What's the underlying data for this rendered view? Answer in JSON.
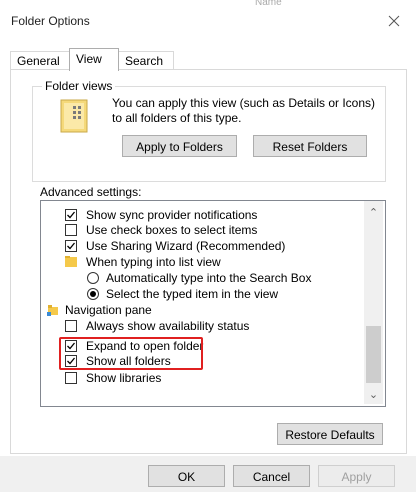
{
  "window": {
    "title": "Folder Options",
    "close_icon": "close-icon",
    "background_text": "Name"
  },
  "tabs": [
    {
      "label": "General",
      "active": false
    },
    {
      "label": "View",
      "active": true
    },
    {
      "label": "Search",
      "active": false
    }
  ],
  "folder_views": {
    "group_label": "Folder views",
    "description": "You can apply this view (such as Details or Icons) to all folders of this type.",
    "apply_button": "Apply to Folders",
    "reset_button": "Reset Folders"
  },
  "advanced": {
    "label": "Advanced settings:",
    "items": [
      {
        "type": "checkbox",
        "label": "Show sync provider notifications",
        "checked": true
      },
      {
        "type": "checkbox",
        "label": "Use check boxes to select items",
        "checked": false
      },
      {
        "type": "checkbox",
        "label": "Use Sharing Wizard (Recommended)",
        "checked": true
      },
      {
        "type": "folder",
        "label": "When typing into list view"
      },
      {
        "type": "radio",
        "label": "Automatically type into the Search Box",
        "selected": false
      },
      {
        "type": "radio",
        "label": "Select the typed item in the view",
        "selected": true
      },
      {
        "type": "nav",
        "label": "Navigation pane"
      },
      {
        "type": "checkbox",
        "label": "Always show availability status",
        "checked": false
      },
      {
        "type": "checkbox",
        "label": "Expand to open folder",
        "checked": true
      },
      {
        "type": "checkbox",
        "label": "Show all folders",
        "checked": true
      },
      {
        "type": "checkbox",
        "label": "Show libraries",
        "checked": false
      }
    ],
    "highlight_color": "#e02020"
  },
  "restore_defaults": "Restore Defaults",
  "footer": {
    "ok": "OK",
    "cancel": "Cancel",
    "apply": "Apply"
  }
}
